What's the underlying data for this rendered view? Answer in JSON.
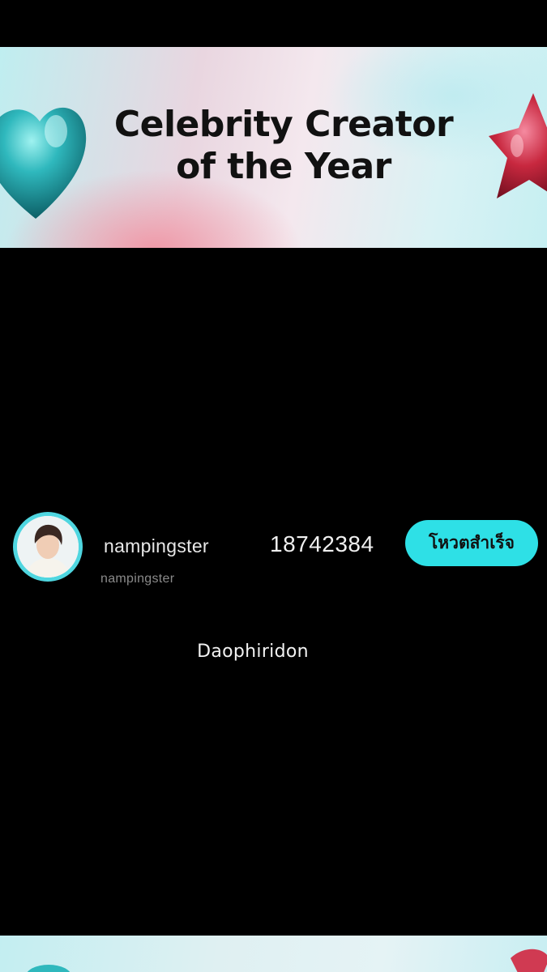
{
  "banner": {
    "title_line1": "Celebrity Creator",
    "title_line2": "of the Year",
    "decor_left": "heart-icon",
    "decor_right": "star-icon"
  },
  "entry": {
    "display_name": "nampingster",
    "username": "nampingster",
    "vote_count": "18742384",
    "vote_button_label": "โหวตสำเร็จ",
    "button_color": "#2ee0e6"
  },
  "watermark": "Daophiridon"
}
